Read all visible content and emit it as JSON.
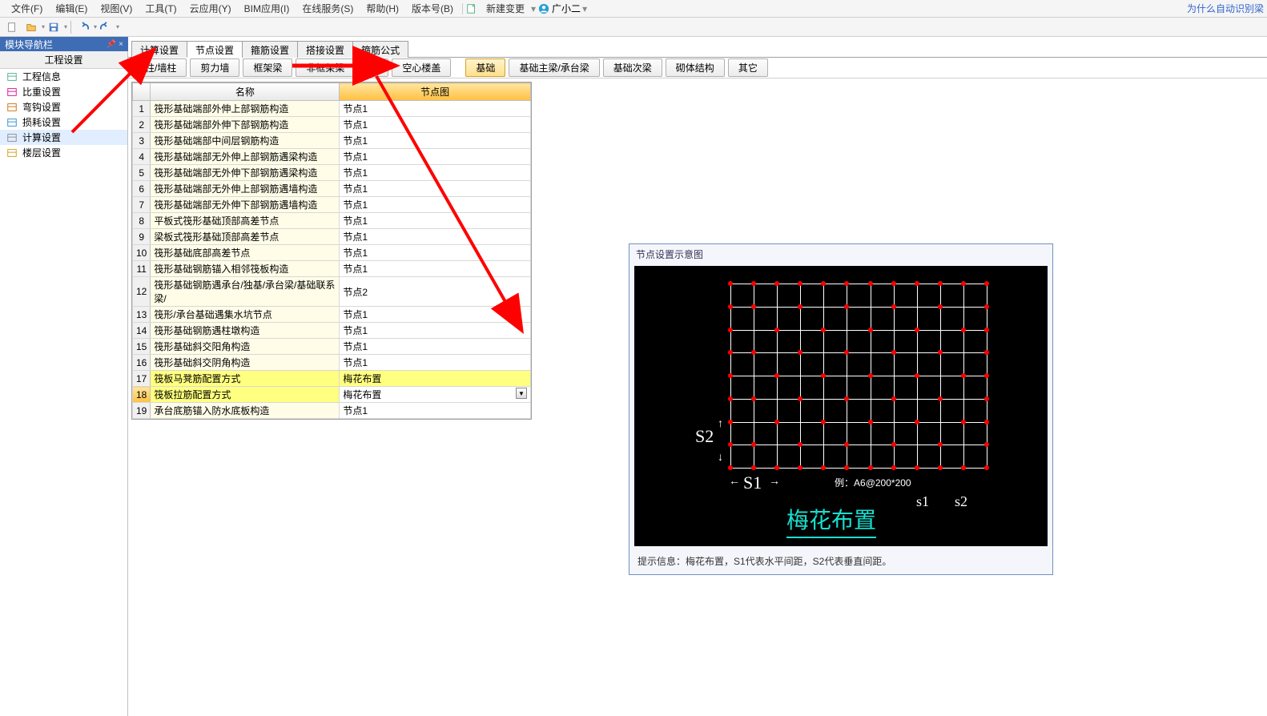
{
  "menu": {
    "file": "文件(F)",
    "edit": "编辑(E)",
    "view": "视图(V)",
    "tool": "工具(T)",
    "cloud": "云应用(Y)",
    "bim": "BIM应用(I)",
    "online": "在线服务(S)",
    "help": "帮助(H)",
    "version": "版本号(B)",
    "newchange": "新建变更",
    "user": "广小二",
    "toplink": "为什么自动识别梁"
  },
  "nav": {
    "panel_title": "模块导航栏",
    "header": "工程设置",
    "items": [
      {
        "label": "工程信息"
      },
      {
        "label": "比重设置"
      },
      {
        "label": "弯钩设置"
      },
      {
        "label": "损耗设置"
      },
      {
        "label": "计算设置"
      },
      {
        "label": "楼层设置"
      }
    ],
    "selected_index": 4
  },
  "tabs1": [
    "计算设置",
    "节点设置",
    "箍筋设置",
    "搭接设置",
    "箍筋公式"
  ],
  "tabs1_active": 1,
  "tabs2": [
    "柱/墙柱",
    "剪力墙",
    "框架梁",
    "非框架梁",
    "板",
    "空心楼盖",
    "基础",
    "基础主梁/承台梁",
    "基础次梁",
    "砌体结构",
    "其它"
  ],
  "tabs2_active": 6,
  "table": {
    "headers": [
      "名称",
      "节点图"
    ],
    "rows": [
      {
        "n": 1,
        "name": "筏形基础端部外伸上部钢筋构造",
        "val": "节点1"
      },
      {
        "n": 2,
        "name": "筏形基础端部外伸下部钢筋构造",
        "val": "节点1"
      },
      {
        "n": 3,
        "name": "筏形基础端部中间层钢筋构造",
        "val": "节点1"
      },
      {
        "n": 4,
        "name": "筏形基础端部无外伸上部钢筋遇梁构造",
        "val": "节点1"
      },
      {
        "n": 5,
        "name": "筏形基础端部无外伸下部钢筋遇梁构造",
        "val": "节点1"
      },
      {
        "n": 6,
        "name": "筏形基础端部无外伸上部钢筋遇墙构造",
        "val": "节点1"
      },
      {
        "n": 7,
        "name": "筏形基础端部无外伸下部钢筋遇墙构造",
        "val": "节点1"
      },
      {
        "n": 8,
        "name": "平板式筏形基础顶部高差节点",
        "val": "节点1"
      },
      {
        "n": 9,
        "name": "梁板式筏形基础顶部高差节点",
        "val": "节点1"
      },
      {
        "n": 10,
        "name": "筏形基础底部高差节点",
        "val": "节点1"
      },
      {
        "n": 11,
        "name": "筏形基础钢筋锚入相邻筏板构造",
        "val": "节点1"
      },
      {
        "n": 12,
        "name": "筏形基础钢筋遇承台/独基/承台梁/基础联系梁/",
        "val": "节点2"
      },
      {
        "n": 13,
        "name": "筏形/承台基础遇集水坑节点",
        "val": "节点1"
      },
      {
        "n": 14,
        "name": "筏形基础钢筋遇柱墩构造",
        "val": "节点1"
      },
      {
        "n": 15,
        "name": "筏形基础斜交阳角构造",
        "val": "节点1"
      },
      {
        "n": 16,
        "name": "筏形基础斜交阴角构造",
        "val": "节点1"
      },
      {
        "n": 17,
        "name": "筏板马凳筋配置方式",
        "val": "梅花布置",
        "hl": true
      },
      {
        "n": 18,
        "name": "筏板拉筋配置方式",
        "val": "梅花布置",
        "hl": true,
        "sel": true
      },
      {
        "n": 19,
        "name": "承台底筋锚入防水底板构造",
        "val": "节点1"
      }
    ]
  },
  "diagram": {
    "title": "节点设置示意图",
    "s1": "S1",
    "s2": "S2",
    "example_prefix": "例：",
    "example_val": "A6@200*200",
    "s1l": "s1",
    "s2l": "s2",
    "name": "梅花布置",
    "hint": "提示信息：梅花布置，S1代表水平间距，S2代表垂直间距。"
  }
}
